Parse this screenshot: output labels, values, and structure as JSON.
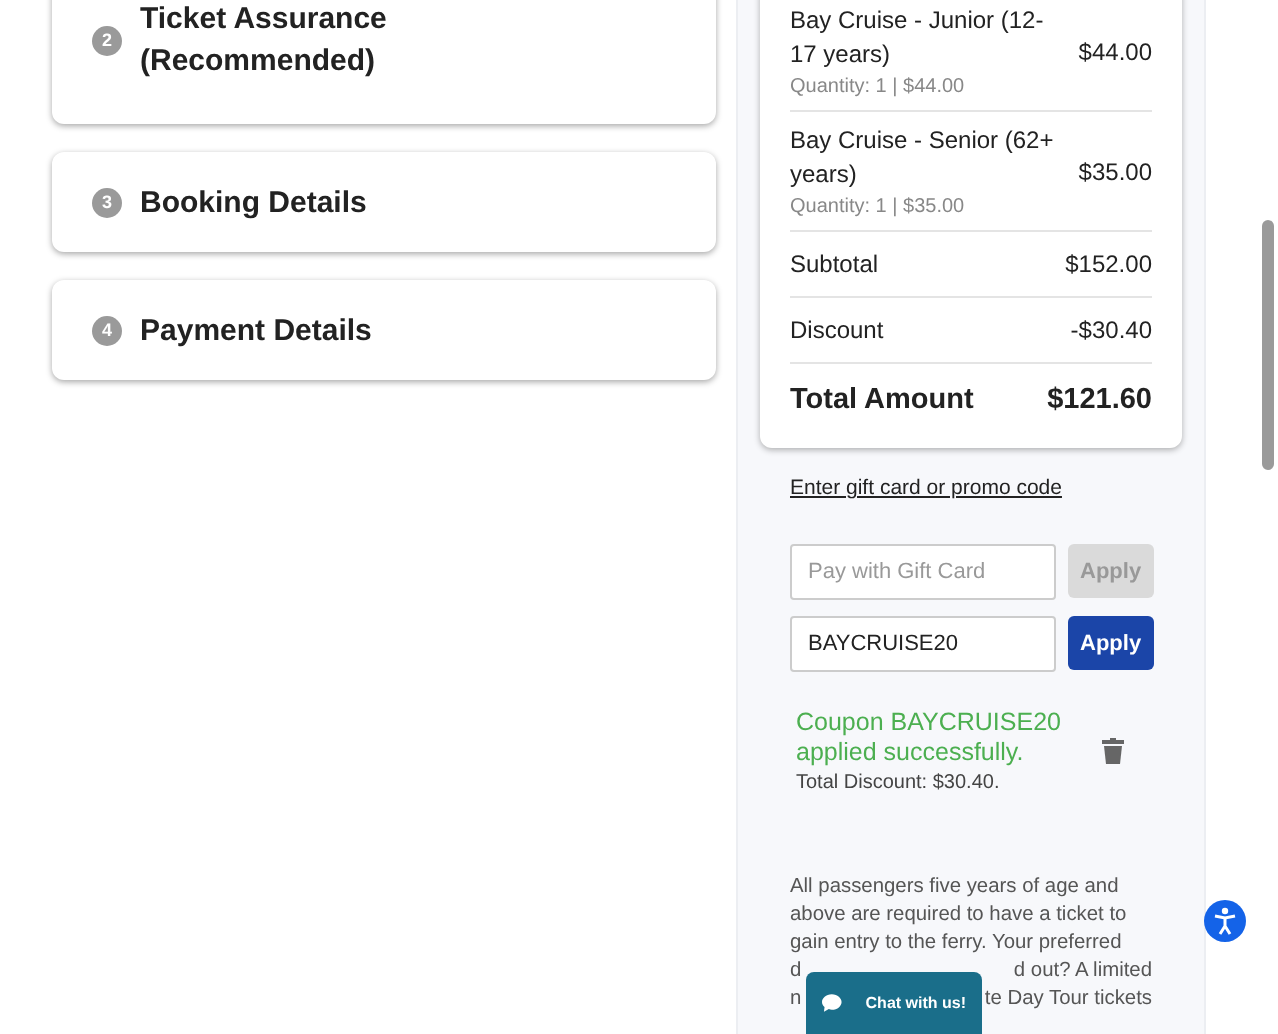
{
  "steps": [
    {
      "number": "2",
      "title": "Ticket Assurance (Recommended)"
    },
    {
      "number": "3",
      "title": "Booking Details"
    },
    {
      "number": "4",
      "title": "Payment Details"
    }
  ],
  "order_summary": {
    "items": [
      {
        "name": "Bay Cruise - Junior (12-17 years)",
        "detail": "Quantity: 1 | $44.00",
        "price": "$44.00"
      },
      {
        "name": "Bay Cruise - Senior (62+ years)",
        "detail": "Quantity: 1 | $35.00",
        "price": "$35.00"
      }
    ],
    "subtotal": {
      "label": "Subtotal",
      "value": "$152.00"
    },
    "discount": {
      "label": "Discount",
      "value": "-$30.40"
    },
    "total": {
      "label": "Total Amount",
      "value": "$121.60"
    }
  },
  "promo": {
    "link": "Enter gift card or promo code",
    "fields": [
      {
        "placeholder": "Pay with Gift Card",
        "button": "Apply",
        "disabled": true
      },
      {
        "value": "BAYCRUISE20",
        "button": "Apply",
        "disabled": false
      }
    ],
    "message": "Coupon BAYCRUISE20 applied successfully.",
    "discount_note": "Total Discount: $30.40."
  },
  "notice_lines": [
    {
      "left": "All passengers five years of age and"
    },
    {
      "left": "above are required to have a ticket to"
    },
    {
      "left": "gain entry to the ferry. Your preferred"
    },
    {
      "left": "d",
      "right": "d out? A limited"
    },
    {
      "left": "n",
      "right": "te Day Tour tickets"
    }
  ],
  "chat_button": "Chat with us!"
}
